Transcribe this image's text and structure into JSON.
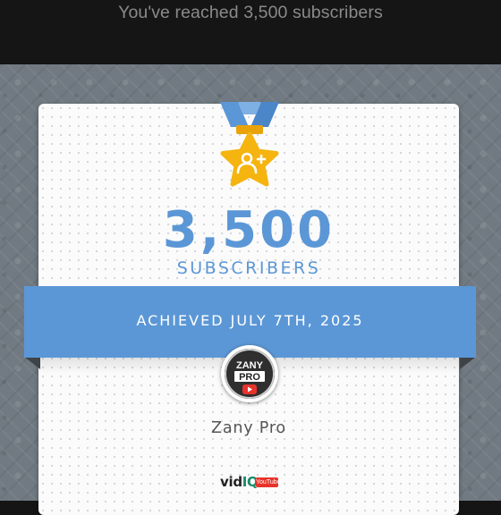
{
  "header": {
    "title": "You've reached 3,500 subscribers"
  },
  "milestone": {
    "count": "3,500",
    "label": "SUBSCRIBERS",
    "achieved": "ACHIEVED JULY 7TH, 2025"
  },
  "channel": {
    "name": "Zany Pro",
    "avatar_text_top": "ZANY",
    "avatar_text_bottom": "PRO"
  },
  "footer": {
    "brand_left": "vid",
    "brand_right": "IQ",
    "badge": "YouTube"
  },
  "icons": {
    "medal": "medal-star-icon",
    "add_user": "add-user-icon",
    "youtube": "youtube-play-icon"
  },
  "colors": {
    "accent": "#5b97d6",
    "medal_gold": "#f5b40f",
    "header_bg": "#151515",
    "header_text": "#8a8a8a",
    "youtube_red": "#e8332b"
  }
}
